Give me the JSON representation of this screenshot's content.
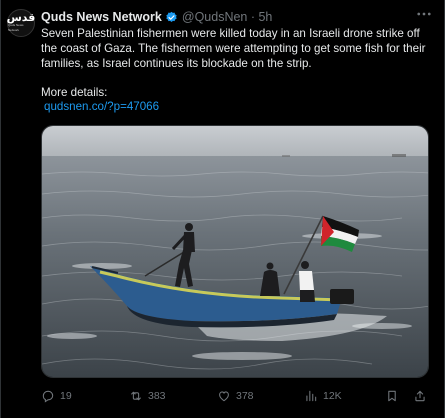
{
  "account": {
    "display_name": "Quds News Network",
    "handle_time": "@QudsNen · 5h",
    "avatar_text": "قدس",
    "avatar_subtext": "Quds News Network",
    "verified_color": "#1d9bf0"
  },
  "tweet": {
    "line1": "Seven Palestinian fishermen were killed today in an Israeli drone strike off",
    "line2": "the coast of Gaza. The fishermen were attempting to get some fish for their",
    "line3": "families, as Israel continues its blockade on the strip.",
    "details_label": "More details:",
    "link_text": "qudsnen.co/?p=47066"
  },
  "media": {
    "subject": "fishermen-boat-with-palestinian-flag-photo"
  },
  "actions": {
    "replies": "19",
    "reposts": "383",
    "likes": "378",
    "views": "12K"
  },
  "icons": {
    "more": "more-icon",
    "reply": "reply-icon",
    "repost": "repost-icon",
    "like": "like-icon",
    "views": "views-icon",
    "bookmark": "bookmark-icon",
    "share": "share-icon"
  },
  "colors": {
    "background": "#000000",
    "text": "#e7e9ea",
    "muted": "#71767b",
    "link": "#1d9bf0"
  }
}
